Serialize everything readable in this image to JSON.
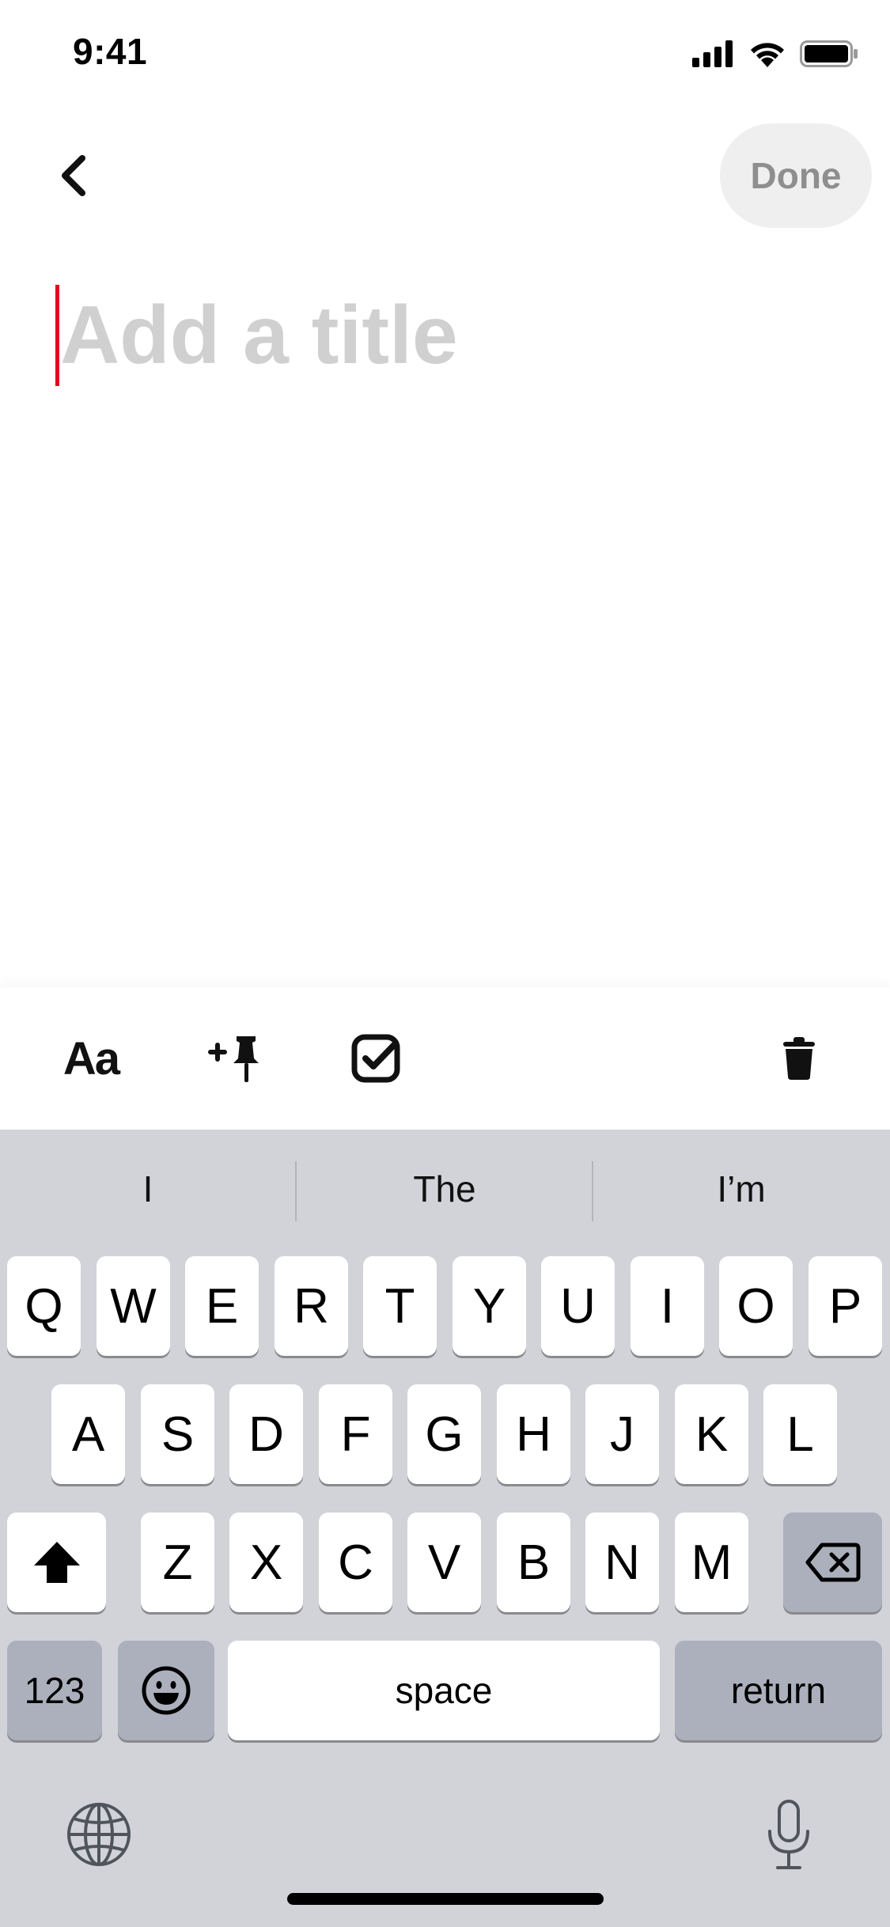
{
  "status_bar": {
    "time": "9:41"
  },
  "header": {
    "done_label": "Done"
  },
  "editor": {
    "title_placeholder": "Add a title",
    "title_value": ""
  },
  "toolbar": {
    "format_label": "Aa"
  },
  "keyboard": {
    "suggestions": [
      "I",
      "The",
      "I’m"
    ],
    "row1": [
      "Q",
      "W",
      "E",
      "R",
      "T",
      "Y",
      "U",
      "I",
      "O",
      "P"
    ],
    "row2": [
      "A",
      "S",
      "D",
      "F",
      "G",
      "H",
      "J",
      "K",
      "L"
    ],
    "row3": [
      "Z",
      "X",
      "C",
      "V",
      "B",
      "N",
      "M"
    ],
    "numbers_label": "123",
    "space_label": "space",
    "return_label": "return"
  },
  "colors": {
    "accent": "#e60023",
    "keyboard_bg": "#d1d3d9",
    "placeholder": "#d0d0d0"
  }
}
